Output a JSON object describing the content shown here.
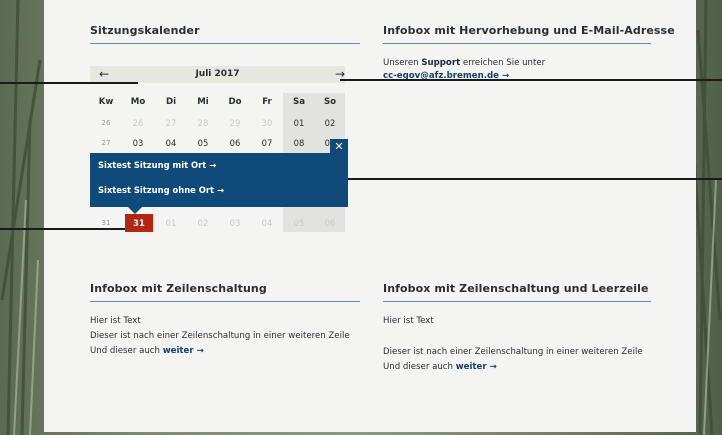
{
  "calendar": {
    "title": "Sitzungskalender",
    "month": "Juli 2017",
    "prev_arrow": "←",
    "next_arrow": "→",
    "headers": [
      "Kw",
      "Mo",
      "Di",
      "Mi",
      "Do",
      "Fr",
      "Sa",
      "So"
    ],
    "rows": [
      {
        "kw": "26",
        "days": [
          "26",
          "27",
          "28",
          "29",
          "30",
          "01",
          "02"
        ]
      },
      {
        "kw": "27",
        "days": [
          "03",
          "04",
          "05",
          "06",
          "07",
          "08",
          "09"
        ]
      },
      {
        "kw": "31",
        "days": [
          "31",
          "01",
          "02",
          "03",
          "04",
          "05",
          "06"
        ]
      }
    ],
    "today": "31"
  },
  "popup": {
    "close": "✕",
    "items": [
      "Sixtest Sitzung mit Ort →",
      "Sixtest Sitzung ohne Ort →"
    ]
  },
  "infobox_email": {
    "title": "Infobox mit Hervorhebung und E-Mail-Adresse",
    "line1_prefix": "Unseren ",
    "line1_bold": "Support",
    "line1_suffix": " erreichen Sie unter",
    "email": "cc-egov@afz.bremen.de →"
  },
  "infobox_zeilen": {
    "title": "Infobox mit Zeilenschaltung",
    "line1": "Hier ist Text",
    "line2": "Dieser ist nach einer Zeilenschaltung in einer weiteren Zeile",
    "line3_prefix": "Und dieser auch ",
    "line3_link": "weiter →"
  },
  "infobox_leerzeile": {
    "title": "Infobox mit Zeilenschaltung und Leerzeile",
    "line1": "Hier ist Text",
    "line2": "Dieser ist nach einer Zeilenschaltung in einer weiteren Zeile",
    "line3_prefix": "Und dieser auch ",
    "line3_link": "weiter →"
  },
  "colors": {
    "accent": "#0f4a7a",
    "today": "#b4260f",
    "rule": "#6b8bb4"
  }
}
